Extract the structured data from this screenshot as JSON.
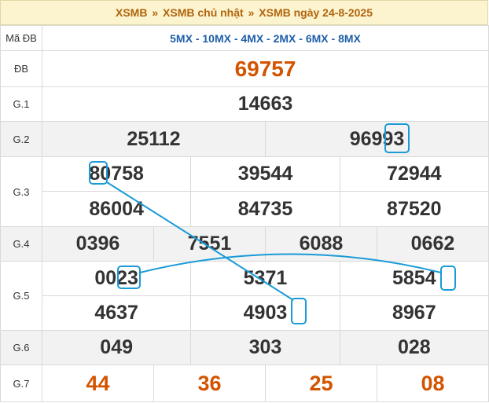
{
  "header": {
    "crumb1": "XSMB",
    "crumb2": "XSMB chủ nhật",
    "crumb3": "XSMB ngày 24-8-2025",
    "sep": "»"
  },
  "rows": {
    "ma_db": {
      "label": "Mã ĐB",
      "value": "5MX - 10MX - 4MX - 2MX - 6MX - 8MX"
    },
    "db": {
      "label": "ĐB",
      "value": "69757"
    },
    "g1": {
      "label": "G.1",
      "values": [
        "14663"
      ]
    },
    "g2": {
      "label": "G.2",
      "values": [
        "25112",
        "96993"
      ]
    },
    "g3": {
      "label": "G.3",
      "values": [
        "80758",
        "39544",
        "72944",
        "86004",
        "84735",
        "87520"
      ]
    },
    "g4": {
      "label": "G.4",
      "values": [
        "0396",
        "7551",
        "6088",
        "0662"
      ]
    },
    "g5": {
      "label": "G.5",
      "values": [
        "0023",
        "5371",
        "5854",
        "4637",
        "4903",
        "8967"
      ]
    },
    "g6": {
      "label": "G.6",
      "values": [
        "049",
        "303",
        "028"
      ]
    },
    "g7": {
      "label": "G.7",
      "values": [
        "44",
        "36",
        "25",
        "08"
      ]
    }
  },
  "colors": {
    "accent": "#d35400",
    "highlight": "#1a9bd7",
    "code": "#1f5ea8",
    "header_bg": "#fcf3cf"
  }
}
